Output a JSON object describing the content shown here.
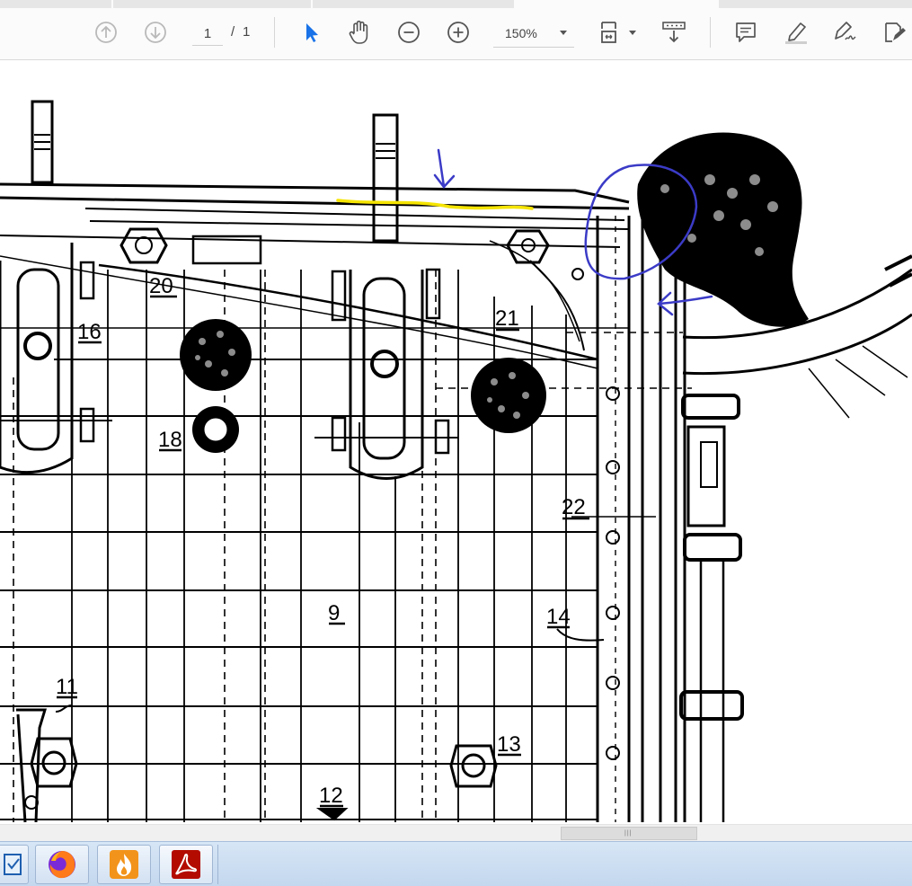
{
  "toolbar": {
    "page_current": "1",
    "page_separator": "/",
    "page_total": "1",
    "zoom_value": "150%",
    "icons": [
      "prev-page-icon",
      "next-page-icon",
      "select-cursor-icon",
      "hand-icon",
      "zoom-out-icon",
      "zoom-in-icon",
      "fit-page-icon",
      "scroll-mode-icon",
      "comment-icon",
      "highlight-icon",
      "sign-icon",
      "edit-icon"
    ],
    "accent_color": "#1a73e8"
  },
  "drawing": {
    "labels": [
      "20",
      "16",
      "21",
      "18",
      "22",
      "9",
      "14",
      "11",
      "13",
      "12"
    ],
    "annotation_colors": {
      "ink": "#3b3bc7",
      "highlight": "#f5e400"
    }
  },
  "taskbar": {
    "apps": [
      "explorer",
      "firefox",
      "fire-app",
      "acrobat"
    ]
  }
}
